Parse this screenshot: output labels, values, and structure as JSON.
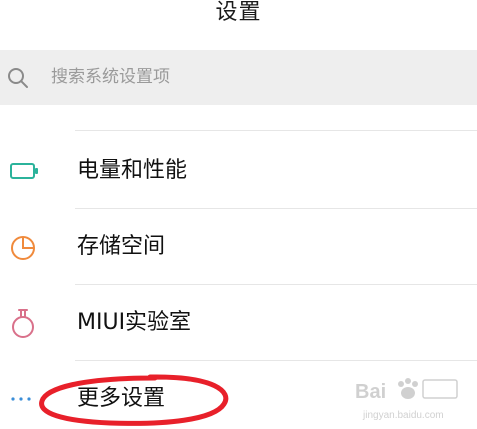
{
  "header": {
    "title": "设置"
  },
  "search": {
    "placeholder": "搜索系统设置项",
    "icon": "search-icon"
  },
  "menu": {
    "items": [
      {
        "label": "电量和性能",
        "icon": "battery-icon",
        "icon_color": "#2bb39b"
      },
      {
        "label": "存储空间",
        "icon": "pie-chart-icon",
        "icon_color": "#f08a3c"
      },
      {
        "label": "MIUI实验室",
        "icon": "flask-icon",
        "icon_color": "#d9708a"
      },
      {
        "label": "更多设置",
        "icon": "more-dots-icon",
        "icon_color": "#3a8ed8"
      }
    ]
  },
  "annotation": {
    "color": "#e8202a"
  }
}
